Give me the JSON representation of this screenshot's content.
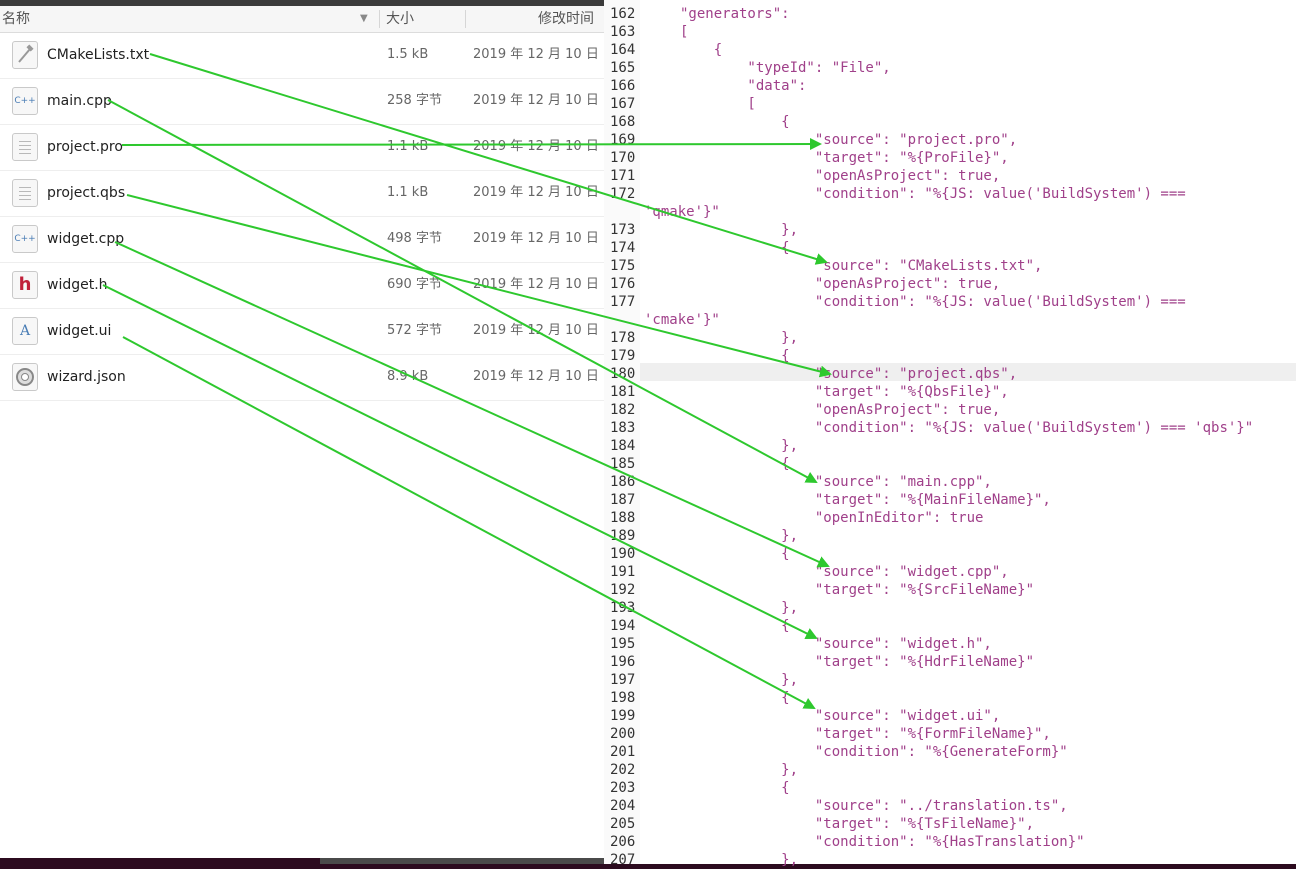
{
  "file_manager": {
    "columns": {
      "name": "名称",
      "size": "大小",
      "modified": "修改时间"
    },
    "files": [
      {
        "name": "CMakeLists.txt",
        "size": "1.5 kB",
        "modified": "2019 年 12 月 10 日",
        "icon": "hammer-icon"
      },
      {
        "name": "main.cpp",
        "size": "258 字节",
        "modified": "2019 年 12 月 10 日",
        "icon": "cpp-file-icon"
      },
      {
        "name": "project.pro",
        "size": "1.1 kB",
        "modified": "2019 年 12 月 10 日",
        "icon": "text-file-icon"
      },
      {
        "name": "project.qbs",
        "size": "1.1 kB",
        "modified": "2019 年 12 月 10 日",
        "icon": "text-file-icon"
      },
      {
        "name": "widget.cpp",
        "size": "498 字节",
        "modified": "2019 年 12 月 10 日",
        "icon": "cpp-file-icon"
      },
      {
        "name": "widget.h",
        "size": "690 字节",
        "modified": "2019 年 12 月 10 日",
        "icon": "header-file-icon"
      },
      {
        "name": "widget.ui",
        "size": "572 字节",
        "modified": "2019 年 12 月 10 日",
        "icon": "ui-file-icon"
      },
      {
        "name": "wizard.json",
        "size": "8.9 kB",
        "modified": "2019 年 12 月 10 日",
        "icon": "json-file-icon"
      }
    ]
  },
  "editor": {
    "current_line": "180",
    "lines": [
      {
        "num": "162",
        "text": "\"generators\":"
      },
      {
        "num": "163",
        "text": "["
      },
      {
        "num": "164",
        "text": "    {"
      },
      {
        "num": "165",
        "text": "        \"typeId\": \"File\","
      },
      {
        "num": "166",
        "text": "        \"data\":"
      },
      {
        "num": "167",
        "text": "        ["
      },
      {
        "num": "168",
        "text": "            {"
      },
      {
        "num": "169",
        "text": "                \"source\": \"project.pro\","
      },
      {
        "num": "170",
        "text": "                \"target\": \"%{ProFile}\","
      },
      {
        "num": "171",
        "text": "                \"openAsProject\": true,"
      },
      {
        "num": "172",
        "text": "                \"condition\": \"%{JS: value('BuildSystem') ==="
      },
      {
        "num": "",
        "text": "'qmake'}\""
      },
      {
        "num": "173",
        "text": "            },"
      },
      {
        "num": "174",
        "text": "            {"
      },
      {
        "num": "175",
        "text": "                \"source\": \"CMakeLists.txt\","
      },
      {
        "num": "176",
        "text": "                \"openAsProject\": true,"
      },
      {
        "num": "177",
        "text": "                \"condition\": \"%{JS: value('BuildSystem') ==="
      },
      {
        "num": "",
        "text": "'cmake'}\""
      },
      {
        "num": "178",
        "text": "            },"
      },
      {
        "num": "179",
        "text": "            {"
      },
      {
        "num": "180",
        "text": "                \"source\": \"project.qbs\","
      },
      {
        "num": "181",
        "text": "                \"target\": \"%{QbsFile}\","
      },
      {
        "num": "182",
        "text": "                \"openAsProject\": true,"
      },
      {
        "num": "183",
        "text": "                \"condition\": \"%{JS: value('BuildSystem') === 'qbs'}\""
      },
      {
        "num": "184",
        "text": "            },"
      },
      {
        "num": "185",
        "text": "            {"
      },
      {
        "num": "186",
        "text": "                \"source\": \"main.cpp\","
      },
      {
        "num": "187",
        "text": "                \"target\": \"%{MainFileName}\","
      },
      {
        "num": "188",
        "text": "                \"openInEditor\": true"
      },
      {
        "num": "189",
        "text": "            },"
      },
      {
        "num": "190",
        "text": "            {"
      },
      {
        "num": "191",
        "text": "                \"source\": \"widget.cpp\","
      },
      {
        "num": "192",
        "text": "                \"target\": \"%{SrcFileName}\""
      },
      {
        "num": "193",
        "text": "            },"
      },
      {
        "num": "194",
        "text": "            {"
      },
      {
        "num": "195",
        "text": "                \"source\": \"widget.h\","
      },
      {
        "num": "196",
        "text": "                \"target\": \"%{HdrFileName}\""
      },
      {
        "num": "197",
        "text": "            },"
      },
      {
        "num": "198",
        "text": "            {"
      },
      {
        "num": "199",
        "text": "                \"source\": \"widget.ui\","
      },
      {
        "num": "200",
        "text": "                \"target\": \"%{FormFileName}\","
      },
      {
        "num": "201",
        "text": "                \"condition\": \"%{GenerateForm}\""
      },
      {
        "num": "202",
        "text": "            },"
      },
      {
        "num": "203",
        "text": "            {"
      },
      {
        "num": "204",
        "text": "                \"source\": \"../translation.ts\","
      },
      {
        "num": "205",
        "text": "                \"target\": \"%{TsFileName}\","
      },
      {
        "num": "206",
        "text": "                \"condition\": \"%{HasTranslation}\""
      },
      {
        "num": "207",
        "text": "            },"
      }
    ]
  },
  "arrow_color": "#2ec82e",
  "code_color": "#a0408a"
}
